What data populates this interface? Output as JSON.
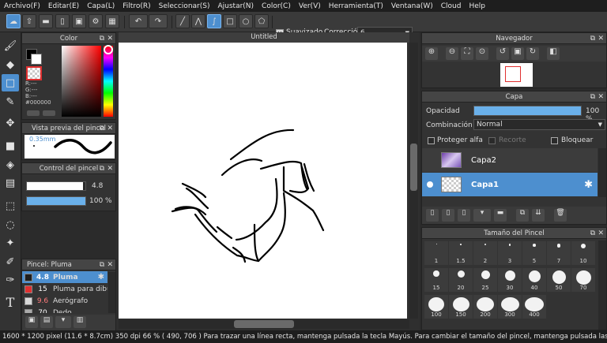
{
  "menu": [
    "Archivo(F)",
    "Editar(E)",
    "Capa(L)",
    "Filtro(R)",
    "Seleccionar(S)",
    "Ajustar(N)",
    "Color(C)",
    "Ver(V)",
    "Herramienta(T)",
    "Ventana(W)",
    "Cloud",
    "Help"
  ],
  "toolbar": {
    "smoothing_label": "Suavizado",
    "correction_label": "Corrección",
    "correction_value": "6"
  },
  "color_panel": {
    "title": "Color",
    "r": "R:---",
    "g": "G:---",
    "b": "B:---",
    "hex": "#000000",
    "accent": "#4d8fcf"
  },
  "preview_panel": {
    "title": "Vista previa del pincel",
    "size": "0.35mm"
  },
  "control_panel": {
    "title": "Control del pincel",
    "size_value": "4.8",
    "opacity_value": "100 %",
    "size_fraction": 0.96,
    "opacity_fraction": 1.0
  },
  "brush_panel": {
    "title": "Pincel: Pluma",
    "items": [
      {
        "size": "4.8",
        "name": "Pluma",
        "color": "#1e1e1e",
        "selected": true
      },
      {
        "size": "15",
        "name": "Pluma para dibu",
        "color": "#e03131",
        "selected": false
      },
      {
        "size": "9.6",
        "name": "Aerógrafo",
        "color": "#d8d8d8",
        "selected": false
      },
      {
        "size": "70",
        "name": "Dedo",
        "color": "#aaa",
        "selected": false
      }
    ]
  },
  "document": {
    "tab_title": "Untitled"
  },
  "navigator": {
    "title": "Navegador"
  },
  "layer_panel": {
    "title": "Capa",
    "opacity_label": "Opacidad",
    "opacity_value": "100 %",
    "blend_label": "Combinación",
    "blend_value": "Normal",
    "protect_alpha": "Proteger alfa",
    "clipping": "Recorte",
    "lock": "Bloquear",
    "layers": [
      {
        "name": "Capa2",
        "selected": false
      },
      {
        "name": "Capa1",
        "selected": true
      }
    ]
  },
  "brush_size_panel": {
    "title": "Tamaño del Pincel",
    "sizes": [
      "1",
      "1.5",
      "2",
      "3",
      "5",
      "7",
      "10",
      "15",
      "20",
      "25",
      "30",
      "40",
      "50",
      "70",
      "100",
      "150",
      "200",
      "300",
      "400"
    ]
  },
  "status": {
    "text": "1600 * 1200 pixel   (11.6 * 8.7cm)   350 dpi   66 %   ( 490, 706 )   Para trazar una línea recta, mantenga pulsada la tecla Mayús. Para cambiar el tamaño del pincel, mantenga pulsada las teclas Ctrl -"
  }
}
